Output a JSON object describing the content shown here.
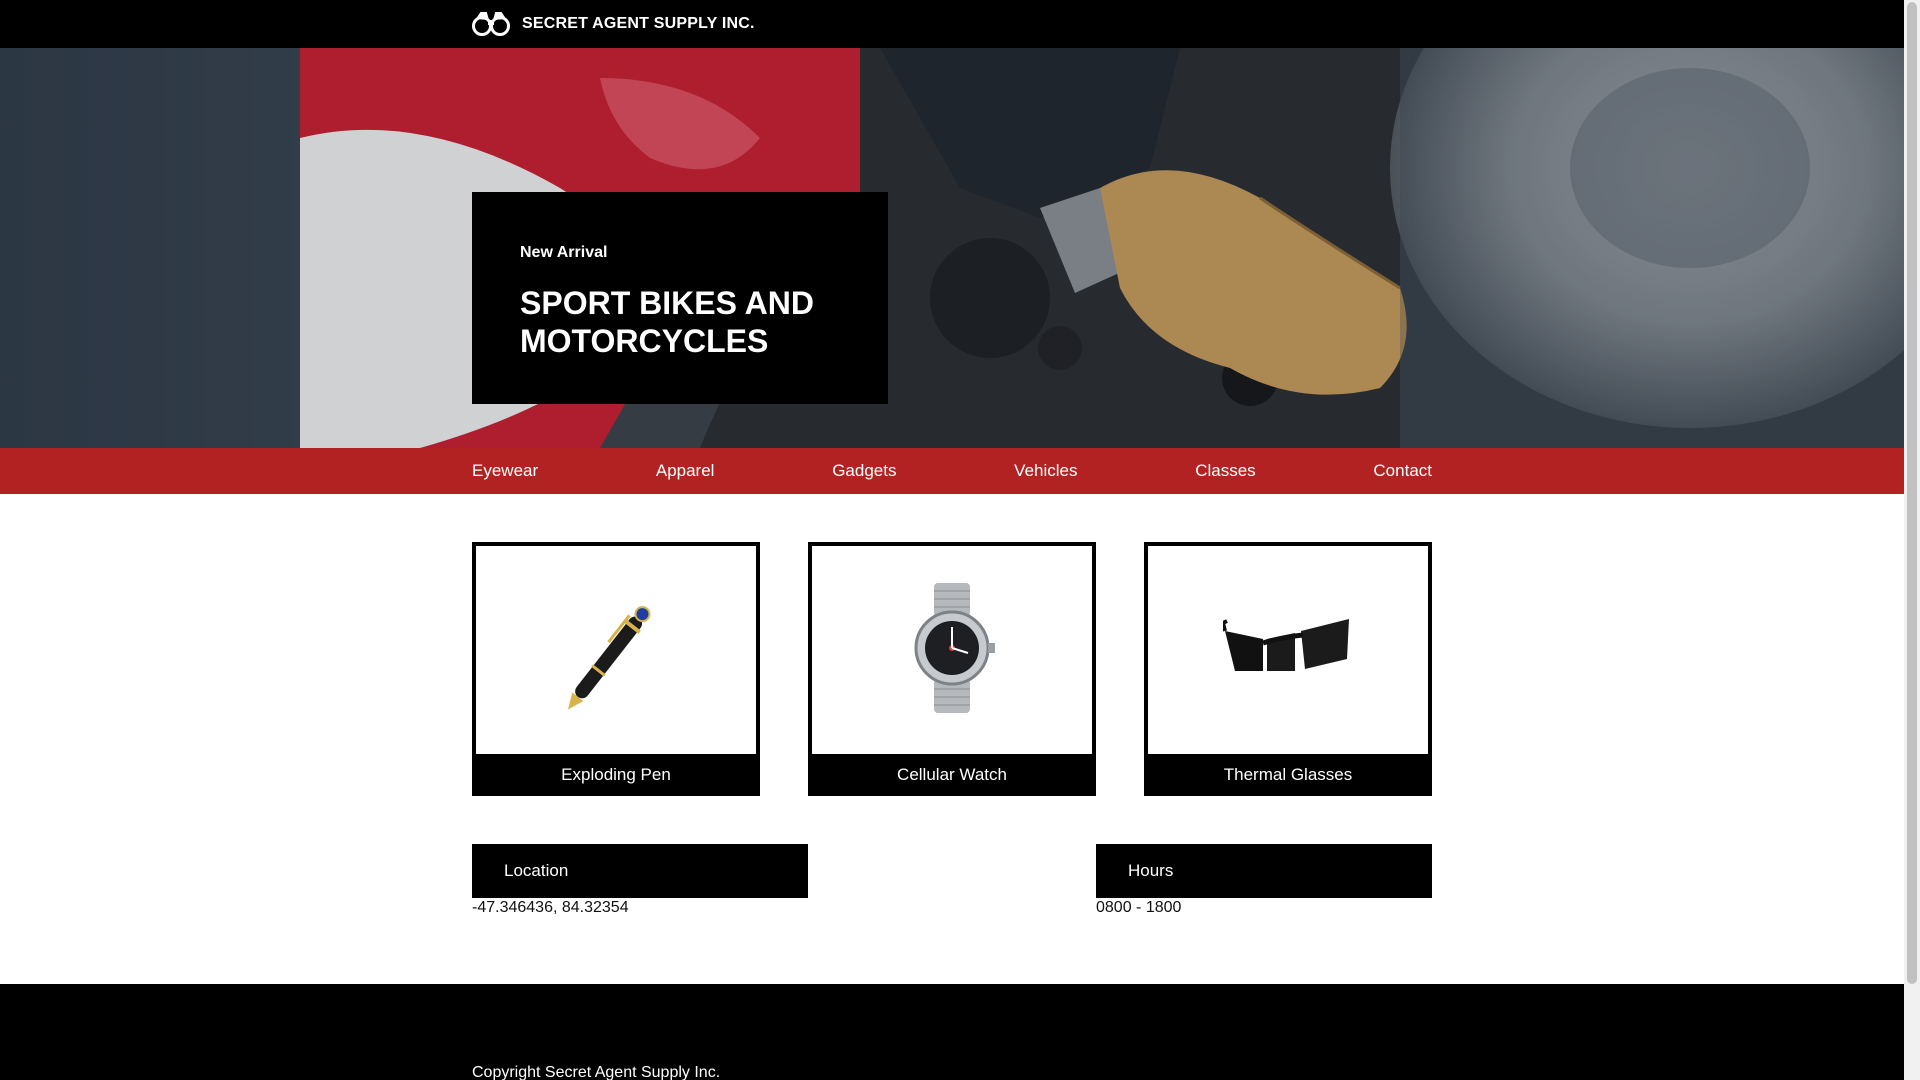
{
  "header": {
    "brand_name": "SECRET AGENT SUPPLY INC.",
    "brand_icon": "binoculars-icon"
  },
  "hero": {
    "eyebrow": "New Arrival",
    "title": "SPORT BIKES AND MOTORCYCLES"
  },
  "nav": {
    "items": [
      {
        "label": "Eyewear"
      },
      {
        "label": "Apparel"
      },
      {
        "label": "Gadgets"
      },
      {
        "label": "Vehicles"
      },
      {
        "label": "Classes"
      },
      {
        "label": "Contact"
      }
    ]
  },
  "products": [
    {
      "name": "Exploding Pen",
      "image": "pen-image"
    },
    {
      "name": "Cellular Watch",
      "image": "watch-image"
    },
    {
      "name": "Thermal Glasses",
      "image": "sunglasses-image"
    }
  ],
  "info": {
    "location": {
      "heading": "Location",
      "value": "-47.346436, 84.32354"
    },
    "hours": {
      "heading": "Hours",
      "value": "0800 - 1800"
    }
  },
  "footer": {
    "copyright": "Copyright Secret Agent Supply Inc."
  },
  "colors": {
    "nav_bg": "#b22222",
    "black": "#000000",
    "white": "#ffffff"
  }
}
